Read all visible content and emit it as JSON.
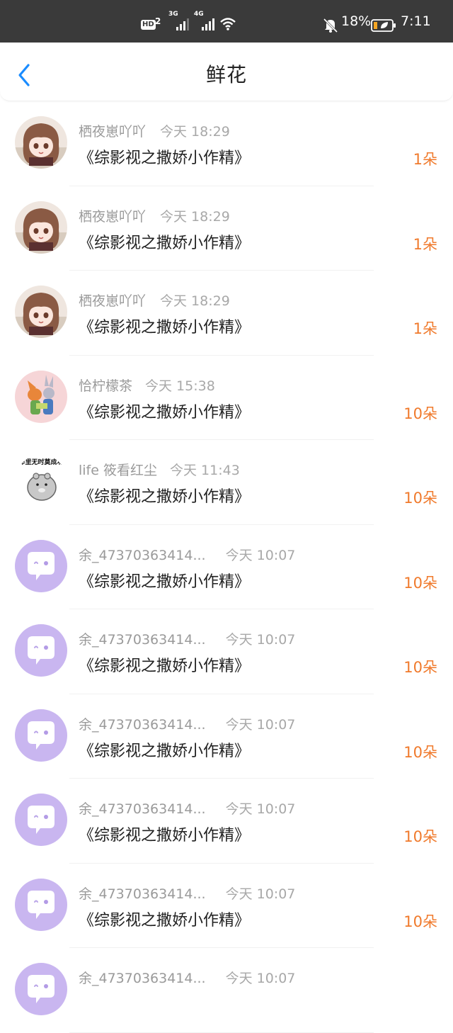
{
  "status_bar": {
    "hd": "HD",
    "sim1": "3G",
    "sim2": "4G",
    "battery_percent": "18%",
    "time": "7:11"
  },
  "nav": {
    "title": "鲜花"
  },
  "colors": {
    "accent": "#1a8cff",
    "count": "#f07a2c",
    "placeholder_avatar": "#c9b6f0"
  },
  "rows": [
    {
      "user": "栖夜崽吖吖",
      "time": "今天 18:29",
      "book": "《综影视之撒娇小作精》",
      "count": "1朵",
      "avatar": "anime-girl"
    },
    {
      "user": "栖夜崽吖吖",
      "time": "今天 18:29",
      "book": "《综影视之撒娇小作精》",
      "count": "1朵",
      "avatar": "anime-girl"
    },
    {
      "user": "栖夜崽吖吖",
      "time": "今天 18:29",
      "book": "《综影视之撒娇小作精》",
      "count": "1朵",
      "avatar": "anime-girl"
    },
    {
      "user": "恰柠檬茶",
      "time": "今天 15:38",
      "book": "《综影视之撒娇小作精》",
      "count": "10朵",
      "avatar": "fox-bunny"
    },
    {
      "user": "life 筱看红尘",
      "time": "今天 11:43",
      "book": "《综影视之撒娇小作精》",
      "count": "10朵",
      "avatar": "hamster"
    },
    {
      "user": "余_47370363414...",
      "time": "今天 10:07",
      "book": "《综影视之撒娇小作精》",
      "count": "10朵",
      "avatar": "default-chat"
    },
    {
      "user": "余_47370363414...",
      "time": "今天 10:07",
      "book": "《综影视之撒娇小作精》",
      "count": "10朵",
      "avatar": "default-chat"
    },
    {
      "user": "余_47370363414...",
      "time": "今天 10:07",
      "book": "《综影视之撒娇小作精》",
      "count": "10朵",
      "avatar": "default-chat"
    },
    {
      "user": "余_47370363414...",
      "time": "今天 10:07",
      "book": "《综影视之撒娇小作精》",
      "count": "10朵",
      "avatar": "default-chat"
    },
    {
      "user": "余_47370363414...",
      "time": "今天 10:07",
      "book": "《综影视之撒娇小作精》",
      "count": "10朵",
      "avatar": "default-chat"
    },
    {
      "user": "余_47370363414...",
      "time": "今天 10:07",
      "book": "",
      "count": "",
      "avatar": "default-chat"
    }
  ]
}
